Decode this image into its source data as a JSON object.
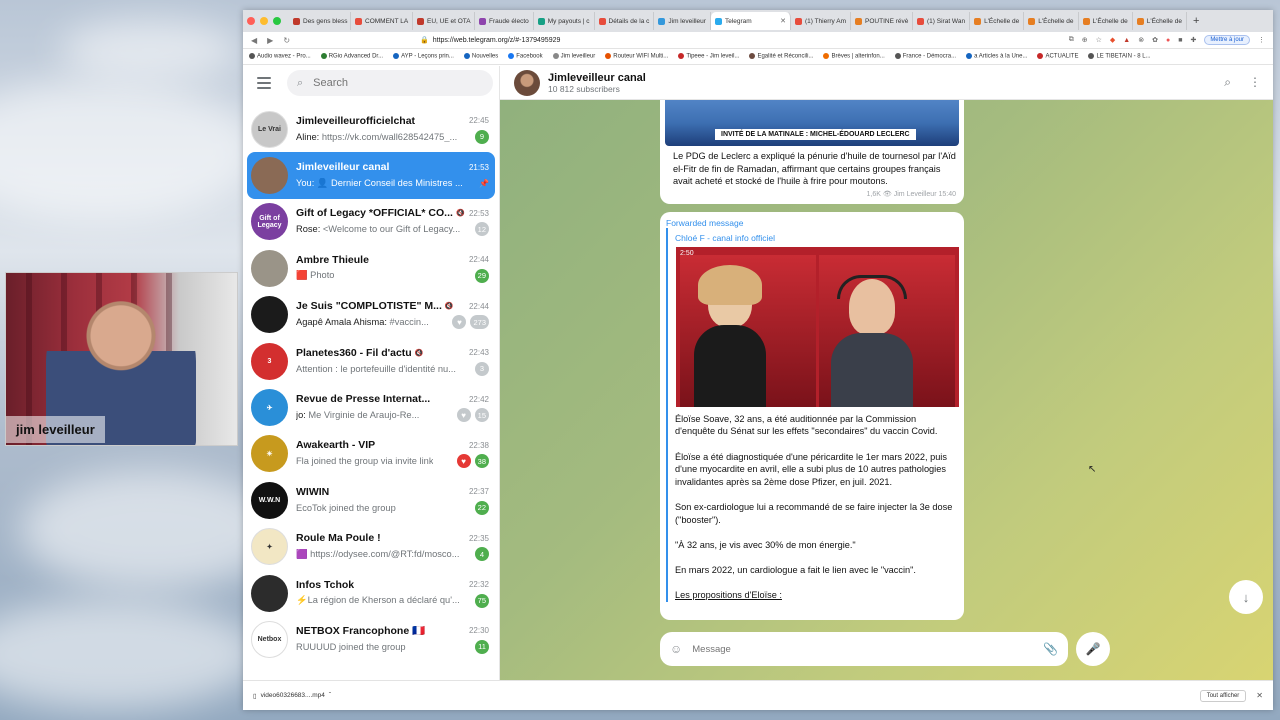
{
  "browser": {
    "tabs": [
      {
        "label": "Des gens bless",
        "color": "#c0392b"
      },
      {
        "label": "COMMENT LA",
        "color": "#e74c3c"
      },
      {
        "label": "EU, UE et OTA",
        "color": "#c0392b"
      },
      {
        "label": "Fraude électo",
        "color": "#8e44ad"
      },
      {
        "label": "My payouts | c",
        "color": "#16a085"
      },
      {
        "label": "Détails de la c",
        "color": "#e74c3c"
      },
      {
        "label": "Jim leveilleur",
        "color": "#3498db"
      },
      {
        "label": "Telegram",
        "color": "#2aabee",
        "active": true
      },
      {
        "label": "(1) Thierry Am",
        "color": "#e74c3c"
      },
      {
        "label": "POUTINE révè",
        "color": "#e67e22"
      },
      {
        "label": "(1) Sirat Wan",
        "color": "#e74c3c"
      },
      {
        "label": "L'Échelle de",
        "color": "#e67e22"
      },
      {
        "label": "L'Échelle de",
        "color": "#e67e22"
      },
      {
        "label": "L'Échelle de",
        "color": "#e67e22"
      },
      {
        "label": "L'Échelle de",
        "color": "#e67e22"
      }
    ],
    "url": "https://web.telegram.org/z/#-1379495929",
    "update_button": "Mettre à jour",
    "bookmarks": [
      "Audio wavez - Pro...",
      "RGio Advanced Dr...",
      "AYP - Leçons prin...",
      "Nouvelles",
      "Facebook",
      "Jim leveilleur",
      "Routeur WIFI Multi...",
      "Tipeee - Jim leveil...",
      "Egalité et Réconcili...",
      "Brèves | alterinfon...",
      "France - Démocra...",
      "a Articles à la Une...",
      "ACTUALITE",
      "LE TIBETAIN - 8 L..."
    ]
  },
  "webcam": {
    "name": "jim leveilleur"
  },
  "search": {
    "placeholder": "Search"
  },
  "chats": [
    {
      "title": "Jimleveilleurofficielchat",
      "time": "22:45",
      "sender": "Aline: ",
      "preview": "https://vk.com/wall628542475_...",
      "badge": "9",
      "badge_type": "green",
      "avatar_color": "#c8c8c8",
      "avatar_text": "Le Vrai"
    },
    {
      "title": "Jimleveilleur canal",
      "time": "21:53",
      "sender": "You: ",
      "preview": "👤 Dernier Conseil des Ministres ...",
      "badge": "",
      "active": true,
      "avatar_color": "#8a6a55",
      "avatar_text": ""
    },
    {
      "title": "Gift of Legacy *OFFICIAL* CO...",
      "time": "22:53",
      "sender": "Rose: ",
      "preview": "<Welcome to our Gift of Legacy...",
      "badge": "12",
      "badge_type": "gray",
      "muted": true,
      "avatar_color": "#7b3fa0",
      "avatar_text": "Gift of Legacy"
    },
    {
      "title": "Ambre Thieule",
      "time": "22:44",
      "sender": "",
      "preview": "🟥 Photo",
      "badge": "29",
      "badge_type": "green",
      "avatar_color": "#9a9488",
      "avatar_text": ""
    },
    {
      "title": "Je Suis \"COMPLOTISTE\" M...",
      "time": "22:44",
      "sender": "Agapê Amala Ahisma: ",
      "preview": "#vaccin...",
      "badge": "273",
      "badge_type": "gray",
      "muted": true,
      "heart": true,
      "heart_color": "#c4c9cc",
      "avatar_color": "#1b1b1b",
      "avatar_text": ""
    },
    {
      "title": "Planetes360 - Fil d'actu",
      "time": "22:43",
      "sender": "",
      "preview": "Attention : le portefeuille d'identité nu...",
      "badge": "3",
      "badge_type": "gray",
      "muted": true,
      "avatar_color": "#d32f2f",
      "avatar_text": "3"
    },
    {
      "title": "Revue de Presse Internat...",
      "time": "22:42",
      "sender": "jo: ",
      "preview": "Me Virginie de Araujo-Re...",
      "badge": "15",
      "badge_type": "gray",
      "heart": true,
      "heart_color": "#c4c9cc",
      "avatar_color": "#2a8fd8",
      "avatar_text": "✈"
    },
    {
      "title": "Awakearth - VIP",
      "time": "22:38",
      "sender": "",
      "preview": "Fla joined the group via invite link",
      "badge": "38",
      "badge_type": "green",
      "heart": true,
      "heart_color": "#e53935",
      "avatar_color": "#c79a1e",
      "avatar_text": "☀"
    },
    {
      "title": "WIWIN",
      "time": "22:37",
      "sender": "",
      "preview": "EcoTok joined the group",
      "badge": "22",
      "badge_type": "green",
      "avatar_color": "#111111",
      "avatar_text": "W.W.N"
    },
    {
      "title": "Roule Ma Poule !",
      "time": "22:35",
      "sender": "",
      "preview": "🟪 https://odysee.com/@RT:fd/mosco...",
      "badge": "4",
      "badge_type": "green",
      "avatar_color": "#f2e7c4",
      "avatar_text": "✦"
    },
    {
      "title": "Infos Tchok",
      "time": "22:32",
      "sender": "",
      "preview": "⚡La région de Kherson a déclaré qu'...",
      "badge": "75",
      "badge_type": "green",
      "avatar_color": "#2c2c2c",
      "avatar_text": ""
    },
    {
      "title": "NETBOX Francophone 🇫🇷",
      "time": "22:30",
      "sender": "",
      "preview": "RUUUUD joined the group",
      "badge": "11",
      "badge_type": "green",
      "avatar_color": "#ffffff",
      "avatar_text": "Netbox"
    }
  ],
  "channel": {
    "title": "Jimleveilleur canal",
    "subscribers": "10 812 subscribers"
  },
  "messages": {
    "m1_banner": "INVITÉ DE LA MATINALE : MICHEL-ÉDOUARD LECLERC",
    "m1_text": "Le PDG de Leclerc a expliqué la pénurie d'huile de tournesol par l'Aïd el-Fitr de fin de Ramadan, affirmant que certains groupes français avait acheté et stocké de l'huile à frire pour moutons.",
    "m1_views": "1,6K",
    "m1_meta": "Jim Leveilleur 15:40",
    "fwd_label": "Forwarded message",
    "fwd_from": "Chloé F - canal info officiel",
    "video_duration": "2:50",
    "p1": "Éloïse Soave, 32 ans, a été auditionnée par la Commission d'enquête du Sénat sur les effets \"secondaires\" du vaccin Covid.",
    "p2": "Éloïse a été diagnostiquée d'une péricardite le 1er mars 2022, puis d'une myocardite en avril, elle a subi plus de 10 autres pathologies invalidantes après sa 2ème dose Pfizer, en juil. 2021.",
    "p3": "Son ex-cardiologue lui a recommandé de se faire injecter la 3e dose (\"booster\").",
    "p4": "\"À 32 ans, je vis avec 30% de mon énergie.\"",
    "p5": "En mars 2022, un cardiologue a fait le lien avec le \"vaccin\".",
    "p6": "Les propositions d'Eloïse :"
  },
  "composer": {
    "placeholder": "Message"
  },
  "downloads": {
    "file": "video60326683....mp4",
    "show_all": "Tout afficher"
  }
}
